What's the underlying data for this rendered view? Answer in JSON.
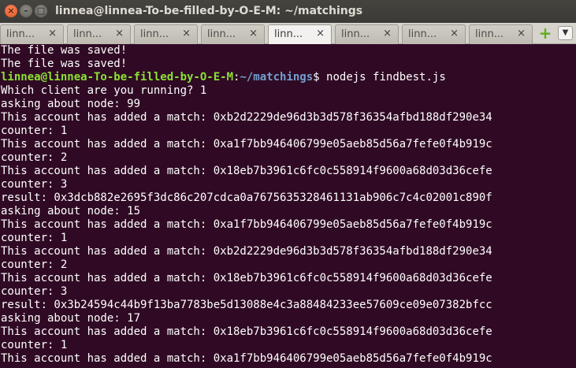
{
  "window": {
    "title": "linnea@linnea-To-be-filled-by-O-E-M: ~/matchings",
    "close_glyph": "×",
    "minimize_glyph": "–",
    "maximize_glyph": "□"
  },
  "tabs": [
    {
      "label": "linn...",
      "close": "×",
      "active": false
    },
    {
      "label": "linn...",
      "close": "×",
      "active": false
    },
    {
      "label": "linn...",
      "close": "×",
      "active": false
    },
    {
      "label": "linn...",
      "close": "×",
      "active": false
    },
    {
      "label": "linn...",
      "close": "×",
      "active": true
    },
    {
      "label": "linn...",
      "close": "×",
      "active": false
    },
    {
      "label": "linn...",
      "close": "×",
      "active": false
    },
    {
      "label": "linn...",
      "close": "×",
      "active": false
    }
  ],
  "tab_actions": {
    "add_glyph": "+",
    "menu_glyph": "▼"
  },
  "colors": {
    "terminal_bg": "#300a24",
    "prompt_user": "#8ae234",
    "prompt_path": "#729fcf",
    "text": "#ffffff"
  },
  "terminal": {
    "line_0": "The file was saved!",
    "line_1": "The file was saved!",
    "prompt_user": "linnea@linnea-To-be-filled-by-O-E-M",
    "prompt_sep": ":",
    "prompt_path": "~/matchings",
    "prompt_symbol": "$ ",
    "command": "nodejs findbest.js",
    "line_3": "Which client are you running? 1",
    "line_4": "asking about node: 99",
    "line_5": "This account has added a match: 0xb2d2229de96d3b3d578f36354afbd188df290e34",
    "line_6": "counter: 1",
    "line_7": "This account has added a match: 0xa1f7bb946406799e05aeb85d56a7fefe0f4b919c",
    "line_8": "counter: 2",
    "line_9": "This account has added a match: 0x18eb7b3961c6fc0c558914f9600a68d03d36cefe",
    "line_10": "counter: 3",
    "line_11": "result: 0x3dcb882e2695f3dc86c207cdca0a7675635328461131ab906c7c4c02001c890f",
    "line_12": "asking about node: 15",
    "line_13": "This account has added a match: 0xa1f7bb946406799e05aeb85d56a7fefe0f4b919c",
    "line_14": "counter: 1",
    "line_15": "This account has added a match: 0xb2d2229de96d3b3d578f36354afbd188df290e34",
    "line_16": "counter: 2",
    "line_17": "This account has added a match: 0x18eb7b3961c6fc0c558914f9600a68d03d36cefe",
    "line_18": "counter: 3",
    "line_19": "result: 0x3b24594c44b9f13ba7783be5d13088e4c3a88484233ee57609ce09e07382bfcc",
    "line_20": "asking about node: 17",
    "line_21": "This account has added a match: 0x18eb7b3961c6fc0c558914f9600a68d03d36cefe",
    "line_22": "counter: 1",
    "line_23": "This account has added a match: 0xa1f7bb946406799e05aeb85d56a7fefe0f4b919c"
  }
}
